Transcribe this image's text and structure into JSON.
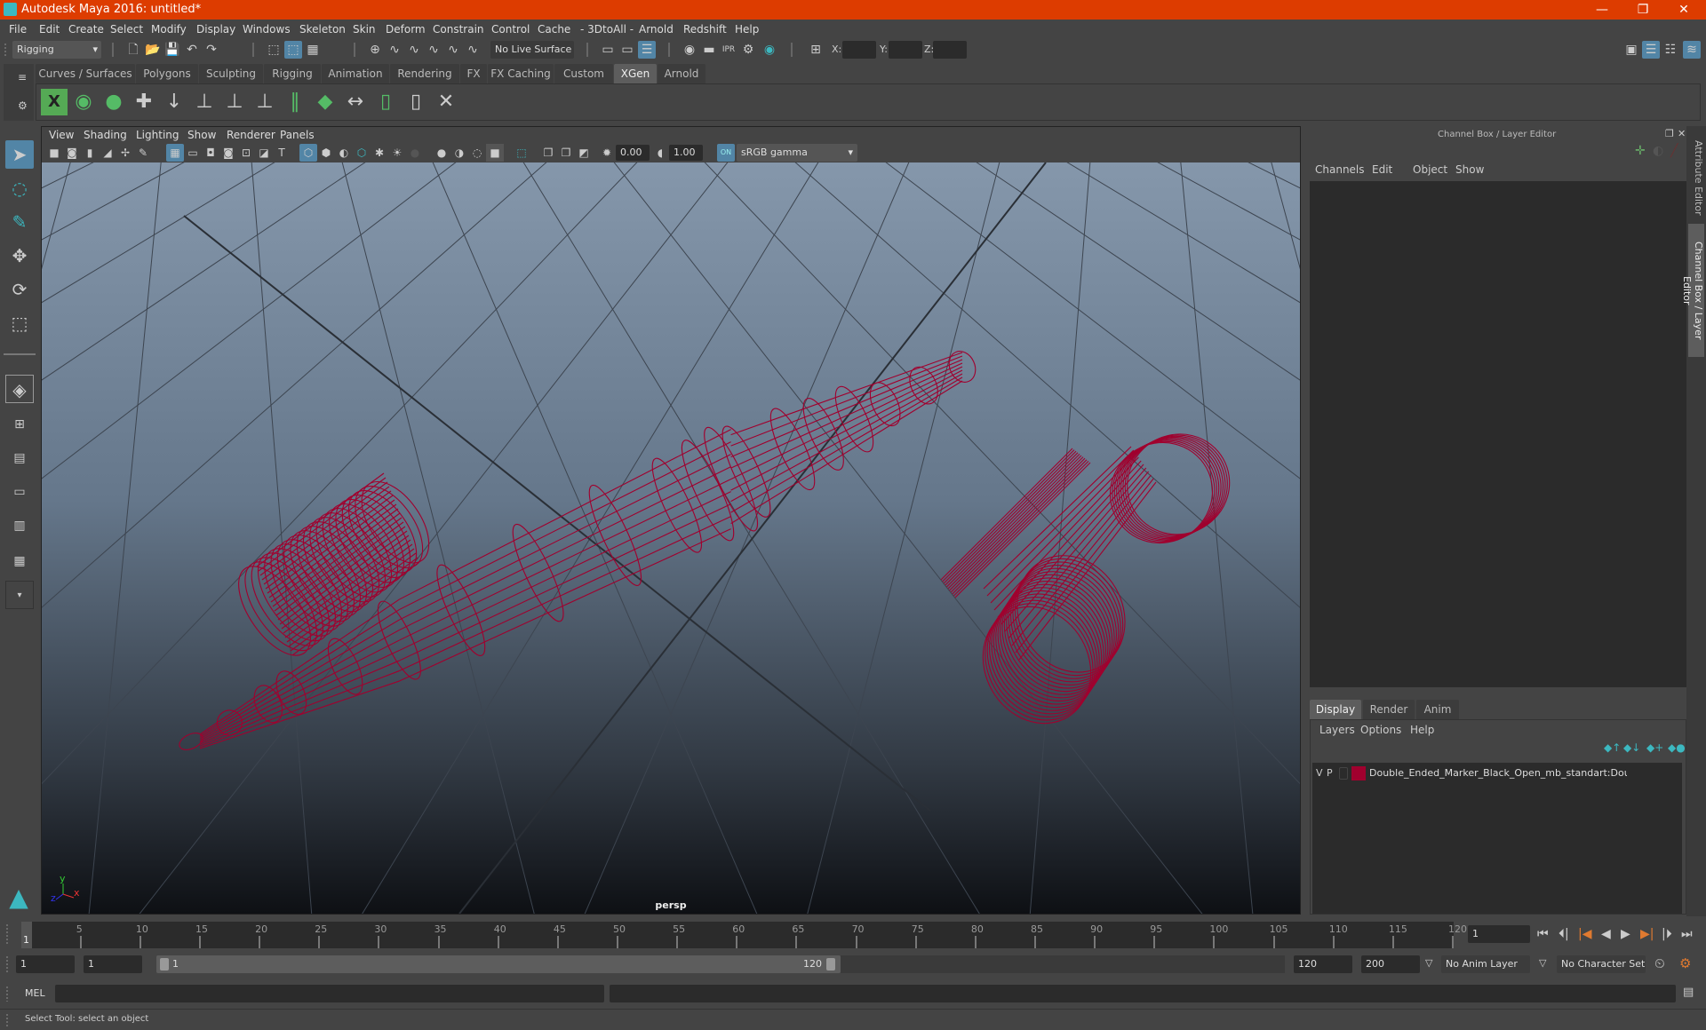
{
  "window": {
    "title": "Autodesk Maya 2016: untitled*",
    "minimize": "—",
    "restore": "❐",
    "close": "✕"
  },
  "menubar": [
    "File",
    "Edit",
    "Create",
    "Select",
    "Modify",
    "Display",
    "Windows",
    "Skeleton",
    "Skin",
    "Deform",
    "Constrain",
    "Control",
    "Cache",
    "- 3DtoAll -",
    "Arnold",
    "Redshift",
    "Help"
  ],
  "statusline": {
    "menuset": "Rigging",
    "live_surface": "No Live Surface",
    "x_label": "X:",
    "y_label": "Y:",
    "z_label": "Z:",
    "x_value": "",
    "y_value": "",
    "z_value": ""
  },
  "shelf": {
    "tabs": [
      "Curves / Surfaces",
      "Polygons",
      "Sculpting",
      "Rigging",
      "Animation",
      "Rendering",
      "FX",
      "FX Caching",
      "Custom",
      "XGen",
      "Arnold"
    ],
    "active_tab": "XGen",
    "icons": [
      "xgen-window-icon",
      "xgen-preview-icon",
      "xgen-clear-preview-icon",
      "add-guides-icon",
      "sculpt-guides-icon",
      "add-guide-icon",
      "rotate-guide-icon",
      "lock-guide-icon",
      "guides-to-curves-icon",
      "grid-paint-icon",
      "flip-guides-icon",
      "select-guides-icon",
      "guide-frame-icon",
      "delete-guides-icon"
    ]
  },
  "viewport": {
    "menu": [
      "View",
      "Shading",
      "Lighting",
      "Show",
      "Renderer",
      "Panels"
    ],
    "exposure": "0.00",
    "gamma": "1.00",
    "color_mgmt_badge": "ON",
    "color_space": "sRGB gamma",
    "camera_label": "persp",
    "axis": {
      "x": "x",
      "y": "y",
      "z": "z"
    },
    "wire_color": "#a0002e"
  },
  "channel_box": {
    "title": "Channel Box / Layer Editor",
    "menu": [
      "Channels",
      "Edit",
      "Object",
      "Show"
    ]
  },
  "layer_editor": {
    "tabs": [
      "Display",
      "Render",
      "Anim"
    ],
    "active_tab": "Display",
    "menu": [
      "Layers",
      "Options",
      "Help"
    ],
    "layers": [
      {
        "visible": "V",
        "playback": "P",
        "color": "#a0002e",
        "name": "Double_Ended_Marker_Black_Open_mb_standart:Double"
      }
    ]
  },
  "side_tabs": [
    "Attribute Editor",
    "Channel Box / Layer Editor"
  ],
  "time_slider": {
    "ticks": [
      "5",
      "10",
      "15",
      "20",
      "25",
      "30",
      "35",
      "40",
      "45",
      "50",
      "55",
      "60",
      "65",
      "70",
      "75",
      "80",
      "85",
      "90",
      "95",
      "100",
      "105",
      "110",
      "115",
      "120"
    ],
    "current_frame_marker": "1",
    "current_frame": "1",
    "range_start": 1,
    "range_end": 120
  },
  "range_slider": {
    "anim_start": "1",
    "playback_start": "1",
    "slider_start_label": "1",
    "slider_end_label": "120",
    "playback_end": "120",
    "anim_end": "200",
    "anim_layer": "No Anim Layer",
    "character_set": "No Character Set"
  },
  "command_line": {
    "language": "MEL",
    "value": ""
  },
  "help_line": "Select Tool: select an object"
}
